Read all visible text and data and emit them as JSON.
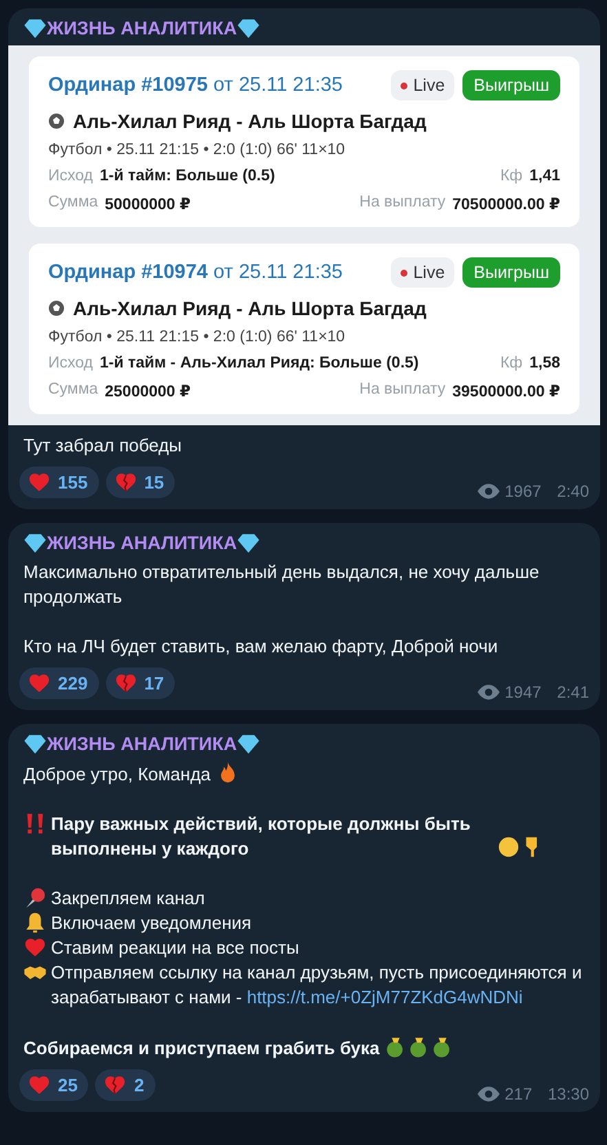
{
  "posts": [
    {
      "channel": "ЖИЗНЬ АНАЛИТИКА",
      "bets": [
        {
          "title": "Ординар #10975",
          "date": "от 25.11 21:35",
          "live": "Live",
          "status": "Выигрыш",
          "match": "Аль-Хилал Рияд - Аль Шорта Багдад",
          "meta": "Футбол • 25.11 21:15 • 2:0 (1:0) 66' 11×10",
          "outcome_label": "Исход",
          "outcome": "1-й тайм: Больше (0.5)",
          "odds_label": "Кф",
          "odds": "1,41",
          "stake_label": "Сумма",
          "stake": "50000000 ₽",
          "payout_label": "На выплату",
          "payout": "70500000.00 ₽"
        },
        {
          "title": "Ординар #10974",
          "date": "от 25.11 21:35",
          "live": "Live",
          "status": "Выигрыш",
          "match": "Аль-Хилал Рияд - Аль Шорта Багдад",
          "meta": "Футбол • 25.11 21:15 • 2:0 (1:0) 66' 11×10",
          "outcome_label": "Исход",
          "outcome": "1-й тайм - Аль-Хилал Рияд: Больше (0.5)",
          "odds_label": "Кф",
          "odds": "1,58",
          "stake_label": "Сумма",
          "stake": "25000000 ₽",
          "payout_label": "На выплату",
          "payout": "39500000.00 ₽"
        }
      ],
      "paragraphs": [
        {
          "kind": "plain",
          "text": "Тут забрал победы"
        }
      ],
      "reactions": [
        {
          "kind": "heart",
          "count": "155"
        },
        {
          "kind": "broken_heart",
          "count": "15"
        }
      ],
      "views": "1967",
      "time": "2:40"
    },
    {
      "channel": "ЖИЗНЬ АНАЛИТИКА",
      "paragraphs": [
        {
          "kind": "plain",
          "text": "Максимально отвратительный день выдался, не хочу дальше продолжать"
        },
        {
          "kind": "plain",
          "text": "Кто на ЛЧ будет ставить, вам желаю фарту, Доброй ночи"
        }
      ],
      "reactions": [
        {
          "kind": "heart",
          "count": "229"
        },
        {
          "kind": "broken_heart",
          "count": "17"
        }
      ],
      "views": "1947",
      "time": "2:41"
    },
    {
      "channel": "ЖИЗНЬ АНАЛИТИКА",
      "paragraphs": [
        {
          "kind": "plain",
          "text": "Доброе утро, Команда"
        },
        {
          "kind": "bold",
          "text": "Пару важных действий, которые должны быть выполнены у каждого"
        },
        {
          "kind": "list",
          "items": [
            {
              "text": "Закрепляем канал"
            },
            {
              "text": "Включаем уведомления"
            },
            {
              "text": "Ставим реакции на все посты"
            },
            {
              "text": "Отправляем ссылку на канал друзьям, пусть присоединяются и зарабатывают с нами - ",
              "link": "https://t.me/+0ZjM77ZKdG4wNDNi"
            }
          ]
        },
        {
          "kind": "bold",
          "text": "Собираемся и приступаем грабить бука"
        }
      ],
      "reactions": [
        {
          "kind": "heart",
          "count": "25"
        },
        {
          "kind": "broken_heart",
          "count": "2"
        }
      ],
      "views": "217",
      "time": "13:30"
    }
  ]
}
